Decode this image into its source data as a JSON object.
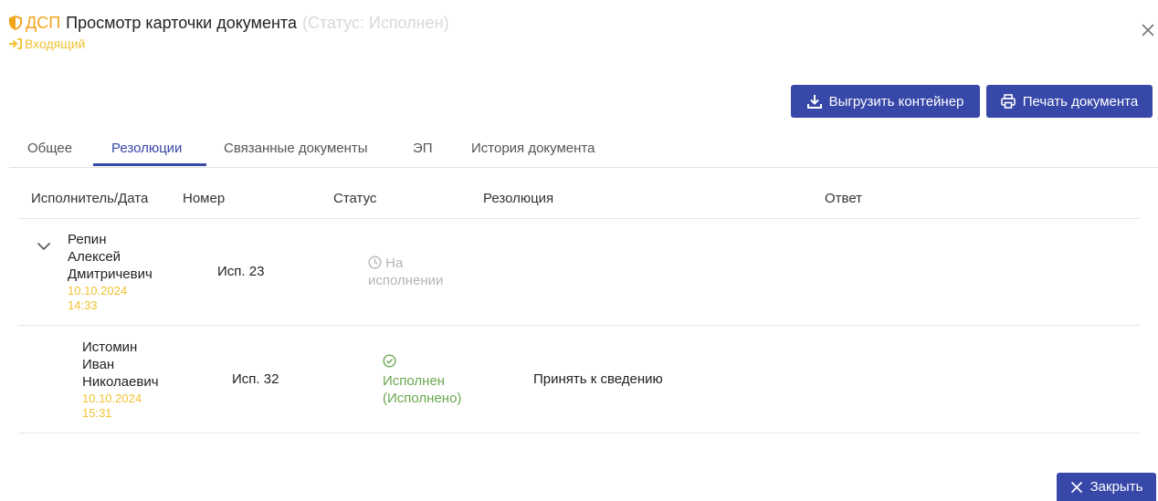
{
  "header": {
    "tag": "ДСП",
    "title": "Просмотр карточки документа",
    "status": "(Статус: Исполнен)",
    "doc_type": "Входящий"
  },
  "toolbar": {
    "export_label": "Выгрузить контейнер",
    "print_label": "Печать документа"
  },
  "tabs": [
    {
      "label": "Общее",
      "active": false
    },
    {
      "label": "Резолюции",
      "active": true
    },
    {
      "label": "Связанные документы",
      "active": false
    },
    {
      "label": "ЭП",
      "active": false
    },
    {
      "label": "История документа",
      "active": false
    }
  ],
  "table": {
    "columns": [
      "Исполнитель/Дата",
      "Номер",
      "Статус",
      "Резолюция",
      "Ответ"
    ],
    "rows": [
      {
        "name": "Репин\nАлексей\nДмитричевич",
        "date": "10.10.2024\n14:33",
        "number": "Исп. 23",
        "status": "На\nисполнении",
        "resolution": "",
        "answer": "",
        "expanded": true
      },
      {
        "name": "Истомин\nИван\nНиколаевич",
        "date": "10.10.2024\n15:31",
        "number": "Исп. 32",
        "status": "Исполнен\n(Исполнено)",
        "resolution": "Принять к сведению",
        "answer": ""
      }
    ]
  },
  "footer": {
    "close_label": "Закрыть"
  },
  "colors": {
    "accent": "#3848a8",
    "warning": "#f2a51a",
    "date": "#f2c231",
    "status_done": "#6aa84f",
    "status_pending": "#b5b5b5"
  },
  "icons": [
    "shield-icon",
    "login-arrow-icon",
    "close-icon",
    "download-icon",
    "printer-icon",
    "chevron-down-icon",
    "clock-icon",
    "check-circle-icon"
  ]
}
